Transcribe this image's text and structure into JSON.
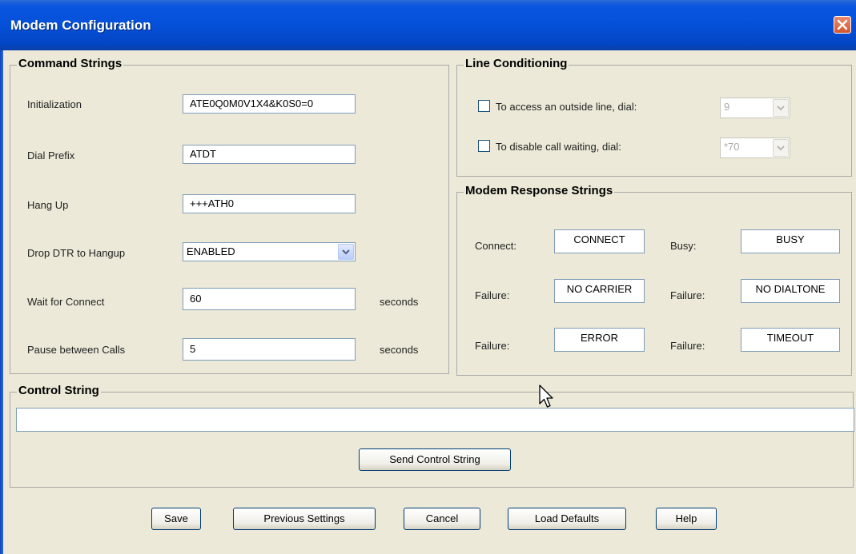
{
  "window": {
    "title": "Modem Configuration"
  },
  "command_strings": {
    "title": "Command Strings",
    "initialization": {
      "label": "Initialization",
      "value": "ATE0Q0M0V1X4&K0S0=0"
    },
    "dial_prefix": {
      "label": "Dial Prefix",
      "value": "ATDT"
    },
    "hang_up": {
      "label": "Hang Up",
      "value": "+++ATH0"
    },
    "drop_dtr": {
      "label": "Drop DTR to Hangup",
      "value": "ENABLED"
    },
    "wait_connect": {
      "label": "Wait for Connect",
      "value": "60",
      "unit": "seconds"
    },
    "pause_calls": {
      "label": "Pause between Calls",
      "value": "5",
      "unit": "seconds"
    }
  },
  "line_conditioning": {
    "title": "Line Conditioning",
    "outside_line": {
      "label": "To access an outside line, dial:",
      "value": "9",
      "checked": false
    },
    "call_waiting": {
      "label": "To disable call waiting, dial:",
      "value": "*70",
      "checked": false
    }
  },
  "modem_response": {
    "title": "Modem Response Strings",
    "rows": [
      {
        "label1": "Connect:",
        "value1": "CONNECT",
        "label2": "Busy:",
        "value2": "BUSY"
      },
      {
        "label1": "Failure:",
        "value1": "NO CARRIER",
        "label2": "Failure:",
        "value2": "NO DIALTONE"
      },
      {
        "label1": "Failure:",
        "value1": "ERROR",
        "label2": "Failure:",
        "value2": "TIMEOUT"
      }
    ]
  },
  "control_string": {
    "title": "Control String",
    "value": "",
    "send_label": "Send Control String"
  },
  "footer": {
    "save": "Save",
    "previous": "Previous Settings",
    "cancel": "Cancel",
    "load_defaults": "Load Defaults",
    "help": "Help"
  },
  "colors": {
    "titlebar": "#0550d8",
    "background": "#ece9d8",
    "field_border": "#7f9db9"
  }
}
